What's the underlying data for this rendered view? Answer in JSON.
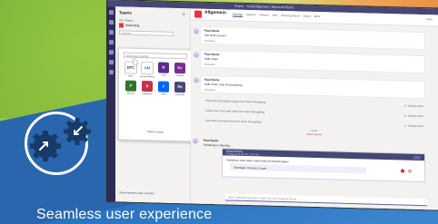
{
  "headline": "Seamless user experience",
  "app": {
    "window_title": "Teams – Kanal Allgemein | Microsoft Teams",
    "teams_pane": {
      "title": "Teams",
      "section": "Ihre Teams",
      "team_name": "Marketing",
      "search_placeholder": "Suchen",
      "apps_search_placeholder": "Nach Apps suchen",
      "apps": [
        {
          "label": "EPC",
          "name": "EPC"
        },
        {
          "label": "AM",
          "name": "Account Manager"
        },
        {
          "label": "R",
          "name": "Hub"
        },
        {
          "label": "Kc",
          "name": "Kanzlei"
        },
        {
          "label": "P",
          "name": "Planner"
        },
        {
          "label": "S",
          "name": "Salesforce"
        },
        {
          "label": "F",
          "name": "Flow"
        },
        {
          "label": "Pb",
          "name": "Power BI"
        }
      ],
      "apps_more": "Weitere Apps",
      "footer": "Team beitreten oder erstellen"
    },
    "channel": {
      "name": "Allgemein",
      "tabs": [
        "Beiträge",
        "Dateien",
        "Notizen",
        "Wiki",
        "Planungsreport",
        "Board",
        "Mehr"
      ],
      "active_tab": "Beiträge",
      "right_label": "Team"
    },
    "messages": [
      {
        "author": "Paul Heins",
        "text": "Wie sieht es aus?",
        "reply": "Antworten"
      },
      {
        "author": "Paul Heins",
        "text": "Hallo Team",
        "reply": "Antworten"
      },
      {
        "author": "Paul Heins",
        "text": "Hallo Team, bitte Rückmeldung",
        "reply": "Antworten"
      }
    ],
    "system_lines": [
      {
        "text": "Paul Heins hat Roland Kappel zum Team hinzugefügt.",
        "date": "17. Oktober 2019"
      },
      {
        "text": "Carola Sorin hat Lukas Jubin zum Team hinzugefügt.",
        "date": "17. Oktober 2019"
      },
      {
        "text": "Paul Heins hat Anke Arndt zum Team hinzugefügt.",
        "date": "17. Oktober 2019"
      }
    ],
    "separator": "Heute",
    "unread_separator": "Zuletzt gelesen",
    "card": {
      "author": "Paul Heins",
      "intro": "Einladung zu Meeting",
      "title": "Besprechung",
      "subtitle": "Freitag 11:00 Uhr bis 12:00 Uhr",
      "row": "Teilnehmer: Paul Heins, Anke Arndt und Roland Kappel",
      "pill_text": "Unterlagen: Konzept_V3.pptx"
    },
    "compose_placeholder": "Neue Unterhaltung starten. Geben Sie zum Erwähnen @ ein.",
    "compose_tools": "A ! ☺ ▦ ⊕ ⋯"
  }
}
